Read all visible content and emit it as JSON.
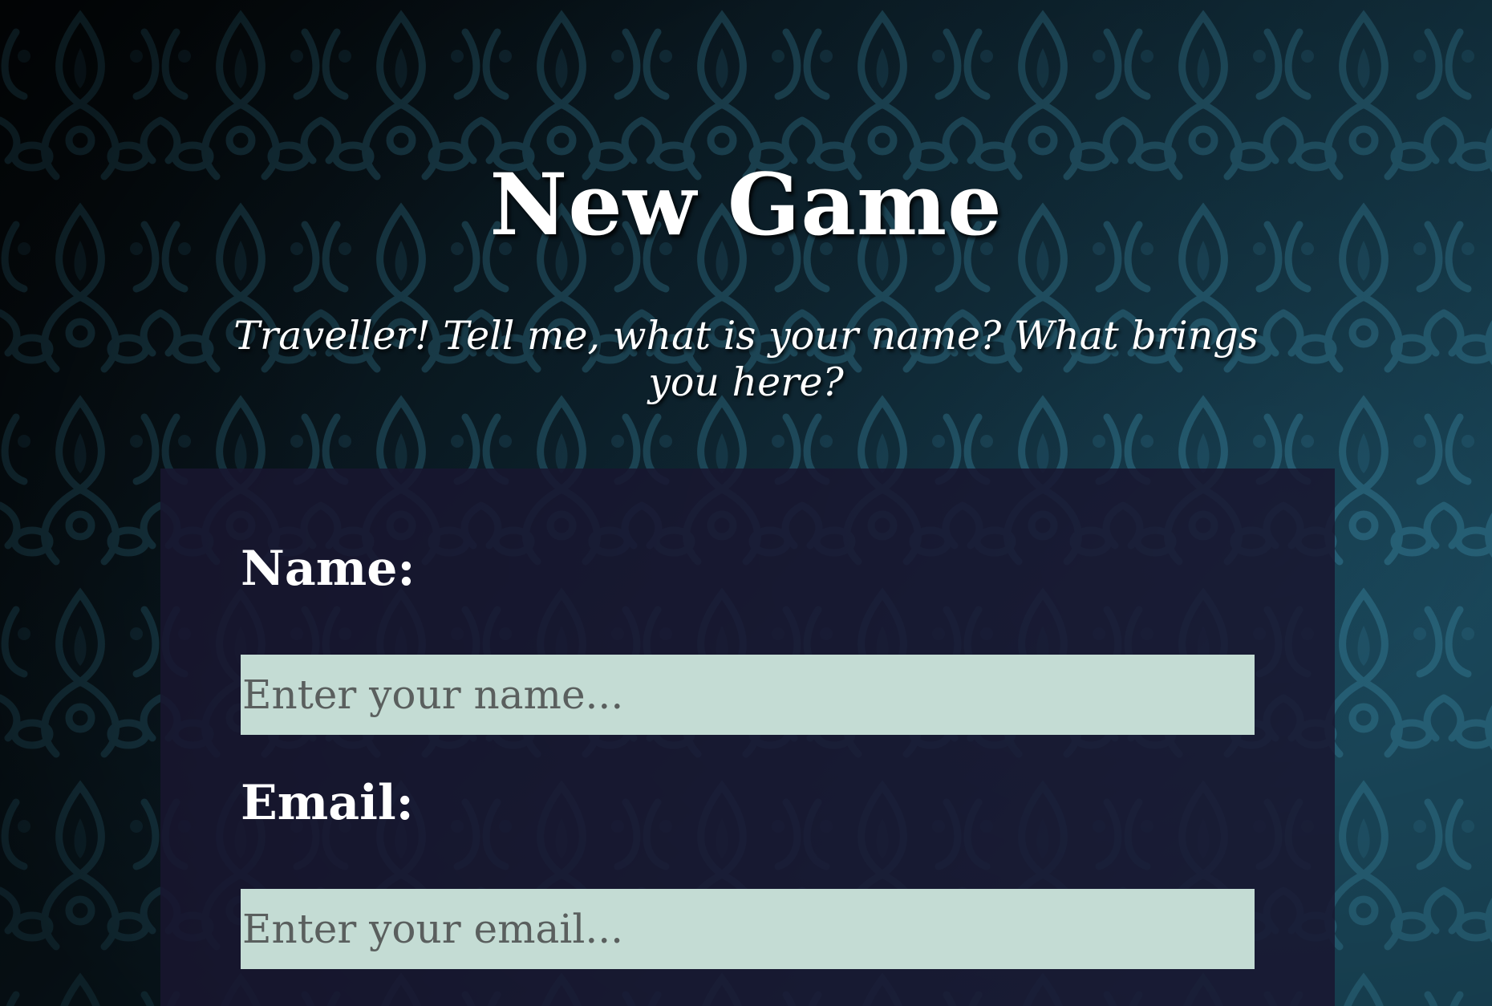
{
  "page": {
    "title": "New Game",
    "subtitle": "Traveller! Tell me, what is your name? What brings you here?"
  },
  "form": {
    "name": {
      "label": "Name:",
      "placeholder": "Enter your name...",
      "value": ""
    },
    "email": {
      "label": "Email:",
      "placeholder": "Enter your email...",
      "value": ""
    }
  },
  "colors": {
    "background": "#0b1a22",
    "pattern": "#2a6f86",
    "panel": "#181630",
    "input_fill": "#c4dcd4",
    "text": "#ffffff",
    "placeholder": "#5a5f5e"
  }
}
